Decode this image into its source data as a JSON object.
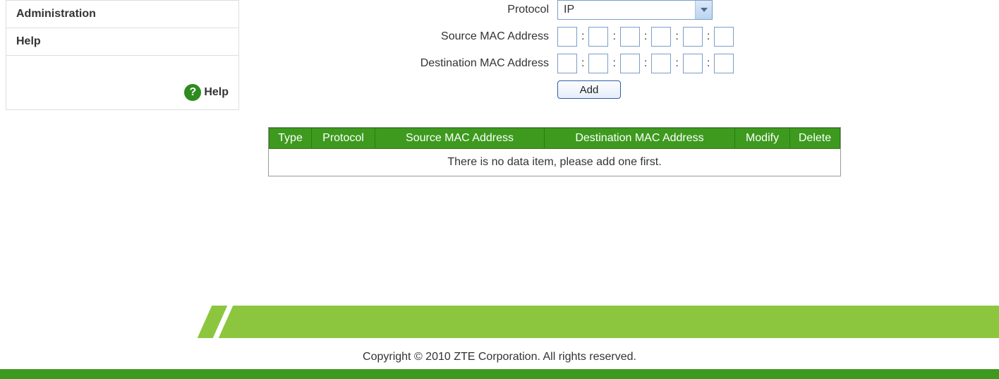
{
  "sidebar": {
    "items": [
      {
        "label": "Administration"
      },
      {
        "label": "Help"
      }
    ],
    "help_link": "Help"
  },
  "form": {
    "protocol_label": "Protocol",
    "protocol_value": "IP",
    "source_mac_label": "Source MAC Address",
    "dest_mac_label": "Destination MAC Address",
    "add_button": "Add"
  },
  "table": {
    "headers": {
      "type": "Type",
      "protocol": "Protocol",
      "src_mac": "Source MAC Address",
      "dst_mac": "Destination MAC Address",
      "modify": "Modify",
      "delete": "Delete"
    },
    "empty_message": "There is no data item, please add one first."
  },
  "footer": {
    "copyright": "Copyright © 2010 ZTE Corporation. All rights reserved."
  }
}
